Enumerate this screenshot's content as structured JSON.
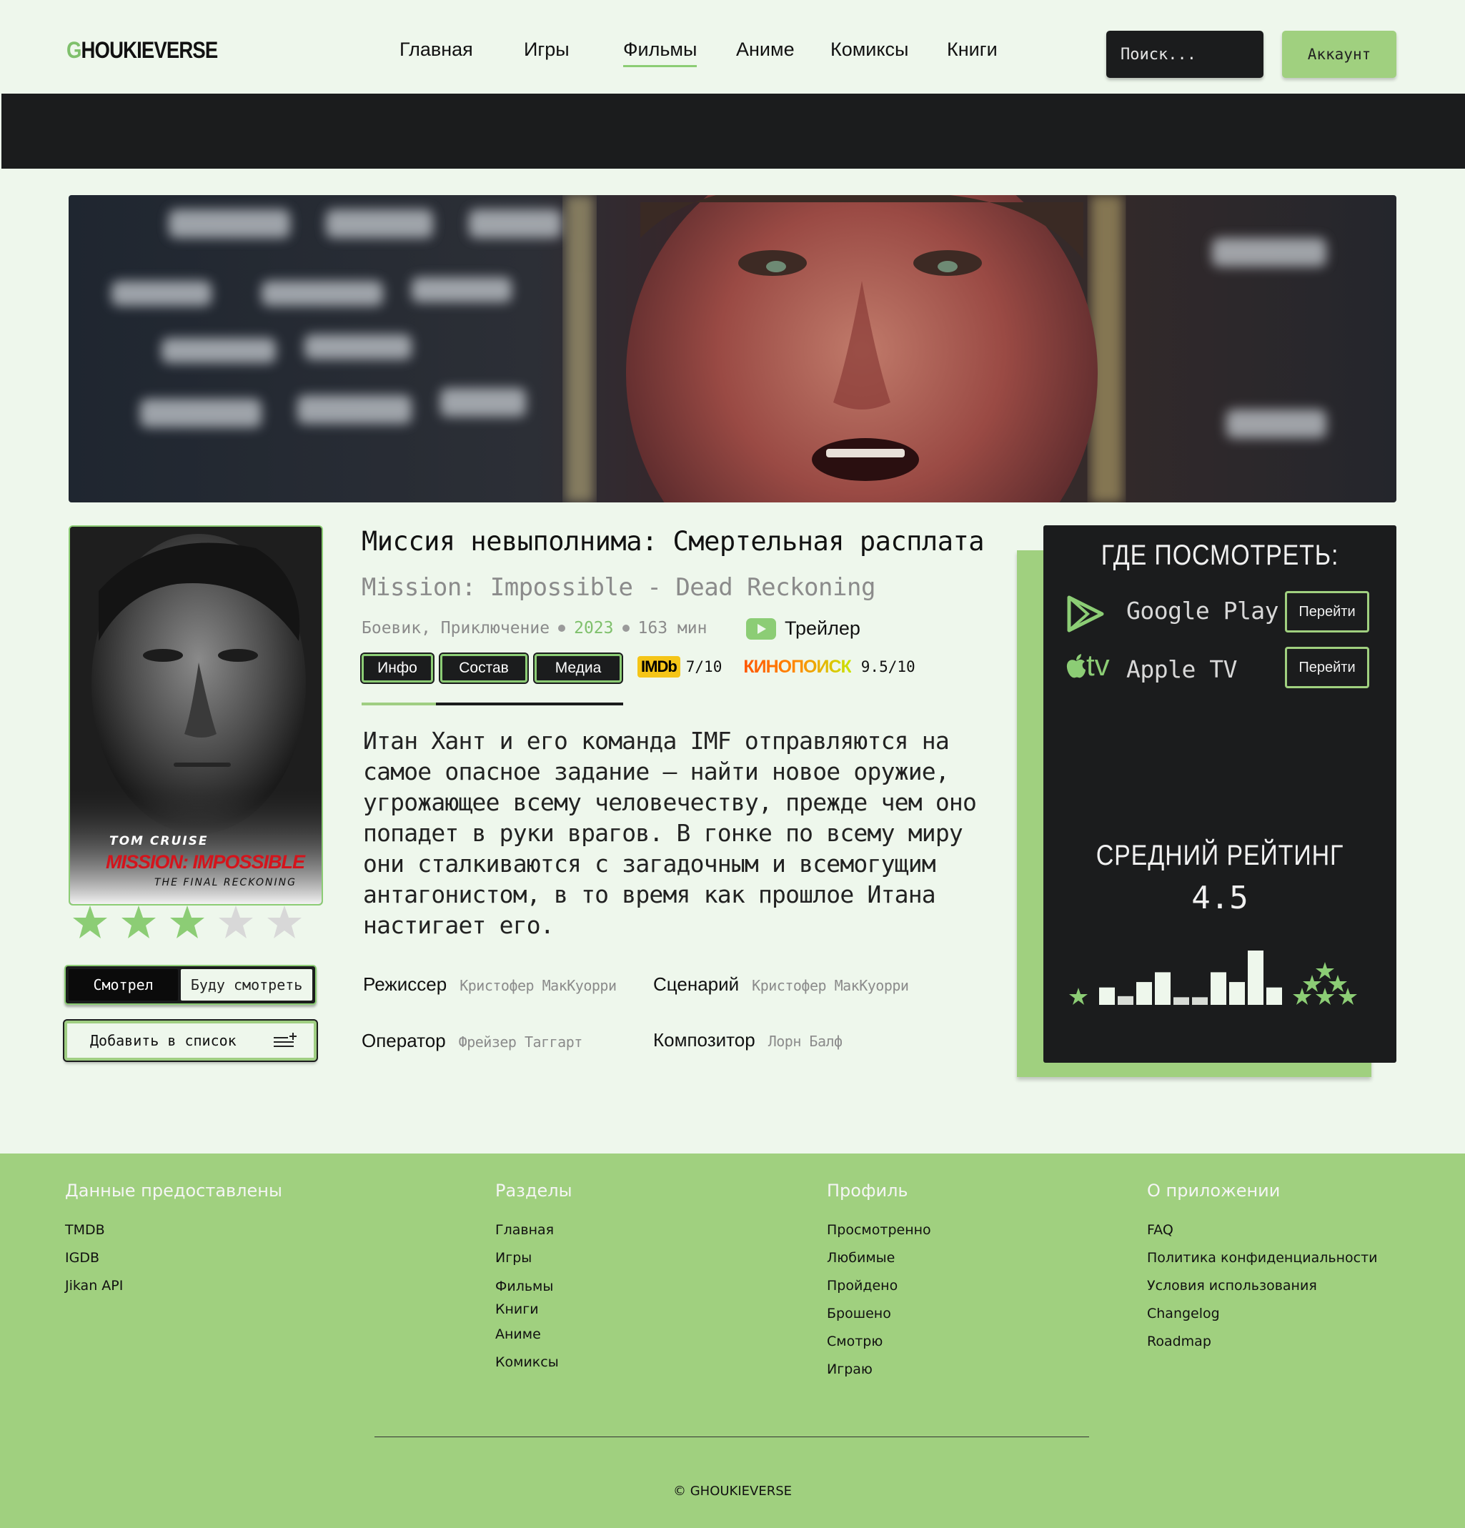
{
  "header": {
    "logo": "GHOUKIEVERSE",
    "nav": [
      "Главная",
      "Игры",
      "Фильмы",
      "Аниме",
      "Комиксы",
      "Книги"
    ],
    "active_nav": "Фильмы",
    "search_placeholder": "Поиск...",
    "account_label": "Аккаунт"
  },
  "poster": {
    "actor": "TOM CRUISE",
    "title_line": "MISSION: IMPOSSIBLE",
    "subtitle_line": "THE FINAL RECKONING"
  },
  "user_rating": {
    "value": 3,
    "max": 5
  },
  "watch_toggle": {
    "watched": "Смотрел",
    "will_watch": "Буду смотреть",
    "selected": "Смотрел"
  },
  "add_list_label": "Добавить в список",
  "movie": {
    "title_ru": "Миссия невыполнима: Смертельная расплата",
    "title_en": "Mission: Impossible - Dead Reckoning",
    "genres": "Боевик, Приключение",
    "year": "2023",
    "duration": "163 мин",
    "trailer_label": "Трейлер",
    "description": "Итан Хант и его команда IMF отправляются на самое опасное задание — найти новое оружие, угрожающее всему человечеству, прежде чем оно попадет в руки врагов. В гонке по всему миру они сталкиваются с загадочным и всемогущим антагонистом, в то время как прошлое Итана настигает его."
  },
  "tabs": [
    "Инфо",
    "Состав",
    "Медиа"
  ],
  "active_tab": "Инфо",
  "ratings": {
    "imdb_logo": "IMDb",
    "imdb": "7/10",
    "kinopoisk_logo": "КИНОПОИСК",
    "kinopoisk": "9.5/10"
  },
  "credits": {
    "director_label": "Режиссер",
    "director": "Кристофер МакКуорри",
    "writer_label": "Сценарий",
    "writer": "Кристофер МакКуорри",
    "operator_label": "Оператор",
    "operator": "Фрейзер Таггарт",
    "composer_label": "Композитор",
    "composer": "Лорн Балф"
  },
  "where_to_watch": {
    "title": "ГДЕ ПОСМОТРЕТЬ:",
    "services": [
      {
        "name": "Google Play",
        "button": "Перейти"
      },
      {
        "name": "Apple TV",
        "button": "Перейти",
        "logo_text": "tv"
      }
    ]
  },
  "average_rating": {
    "title": "СРЕДНИЙ РЕЙТИНГ",
    "value": "4.5",
    "histogram": [
      0.32,
      0.16,
      0.42,
      0.6,
      0.14,
      0.14,
      0.6,
      0.42,
      1.0,
      0.32
    ]
  },
  "colors": {
    "accent_green": "#a0d07f",
    "dark": "#1b1c1d",
    "background": "#eef7ec",
    "imdb_yellow": "#f5c518"
  },
  "footer": {
    "columns": [
      {
        "title": "Данные предоставлены",
        "links": [
          "TMDB",
          "IGDB",
          "Jikan API"
        ]
      },
      {
        "title": "Разделы",
        "links": [
          "Главная",
          "Игры",
          "Фильмы",
          "Книги",
          "Аниме",
          "Комиксы"
        ]
      },
      {
        "title": "Профиль",
        "links": [
          "Просмотренно",
          "Любимые",
          "Пройдено",
          "Брошено",
          "Смотрю",
          "Играю"
        ]
      },
      {
        "title": "О приложении",
        "links": [
          "FAQ",
          "Политика конфиденциальности",
          "Условия использования",
          "Changelog",
          "Roadmap"
        ]
      }
    ],
    "copyright": "© GHOUKIEVERSE"
  }
}
